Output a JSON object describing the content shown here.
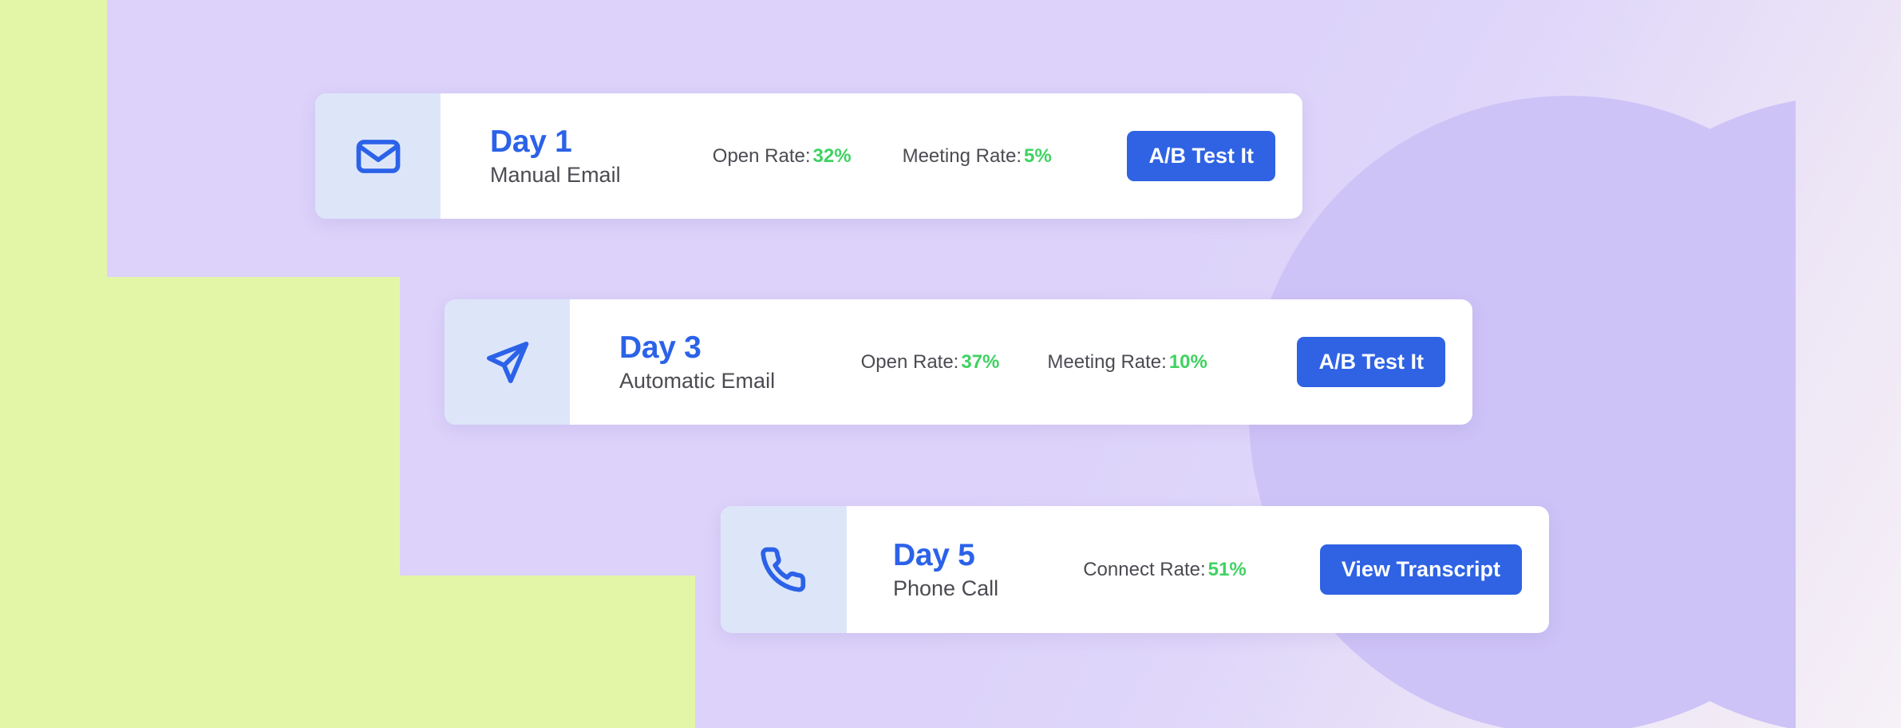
{
  "background": {
    "green": "#E3F6A8",
    "purple": "#DCD2FA",
    "circle_purple": "#CEC3F7",
    "fade_to": "#F6F0F7"
  },
  "theme": {
    "accent_blue": "#2B62E8",
    "button_blue": "#2F63E3",
    "metric_green": "#3FD262",
    "icon_tile_bg": "#DDE6F9",
    "card_bg": "#FFFFFF",
    "body_text": "#4B4B52"
  },
  "cards": [
    {
      "icon": "envelope-icon",
      "day": "Day 1",
      "channel": "Manual Email",
      "metrics": [
        {
          "label": "Open Rate:",
          "value": "32%"
        },
        {
          "label": "Meeting Rate:",
          "value": "5%"
        }
      ],
      "cta": "A/B Test It"
    },
    {
      "icon": "paper-plane-icon",
      "day": "Day 3",
      "channel": "Automatic Email",
      "metrics": [
        {
          "label": "Open Rate:",
          "value": "37%"
        },
        {
          "label": "Meeting Rate:",
          "value": "10%"
        }
      ],
      "cta": "A/B Test It"
    },
    {
      "icon": "phone-icon",
      "day": "Day 5",
      "channel": "Phone Call",
      "metrics": [
        {
          "label": "Connect Rate:",
          "value": "51%"
        }
      ],
      "cta": "View Transcript"
    }
  ]
}
